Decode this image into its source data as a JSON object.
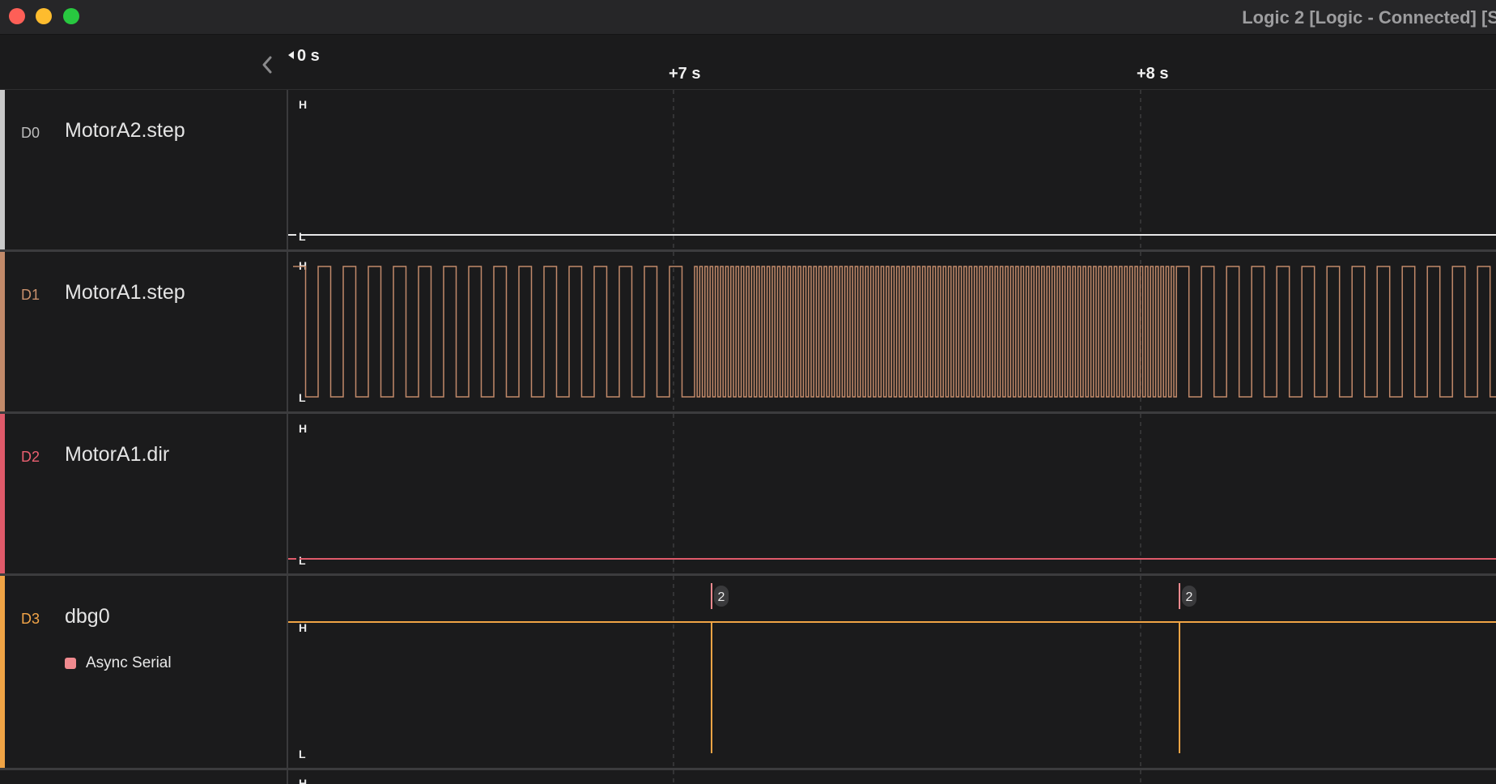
{
  "window": {
    "title": "Logic 2 [Logic - Connected] [S"
  },
  "timeline": {
    "start_label": "0 s",
    "markers": [
      {
        "label": "+7 s"
      },
      {
        "label": "+8 s"
      }
    ]
  },
  "channels": [
    {
      "id": "D0",
      "name": "MotorA2.step",
      "color": "#c9c9c9",
      "id_color": "#bdbdbd",
      "high_label": "H",
      "low_label": "L",
      "signal_state": "low"
    },
    {
      "id": "D1",
      "name": "MotorA1.step",
      "color": "#c28a6a",
      "id_color": "#c8906c",
      "high_label": "H",
      "low_label": "L",
      "signal_state": "pulse-train"
    },
    {
      "id": "D2",
      "name": "MotorA1.dir",
      "color": "#e05a6a",
      "id_color": "#ea5f70",
      "high_label": "H",
      "low_label": "L",
      "signal_state": "low"
    },
    {
      "id": "D3",
      "name": "dbg0",
      "color": "#f0a445",
      "id_color": "#f3a548",
      "high_label": "H",
      "low_label": "L",
      "signal_state": "high",
      "analyzer": {
        "label": "Async Serial",
        "color": "#f08a8f"
      },
      "frames": [
        {
          "value": "2"
        },
        {
          "value": "2"
        }
      ]
    },
    {
      "id": "",
      "name": "",
      "high_label": "H",
      "low_label": ""
    }
  ],
  "colors": {
    "background": "#1b1b1c",
    "grid_dashed": "#444446",
    "d0_wave": "#e8e8e8",
    "d1_wave": "#c28a6a",
    "d2_wave": "#e05a6a",
    "d3_wave": "#f0a445"
  },
  "icons": {
    "collapse": "chevron-left-icon"
  }
}
